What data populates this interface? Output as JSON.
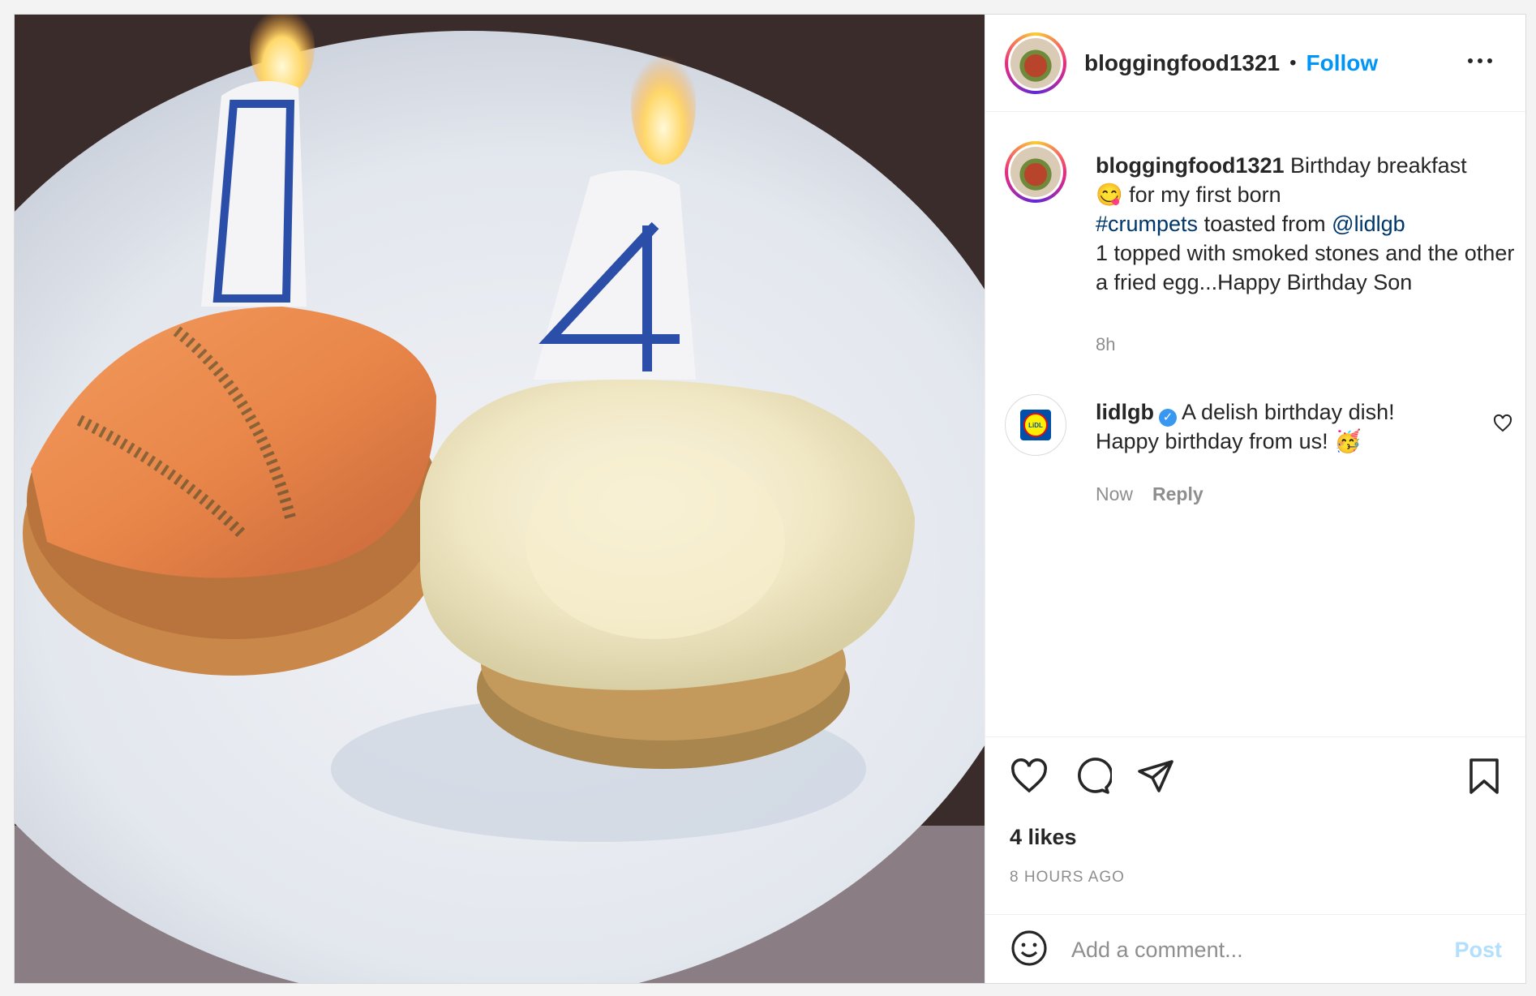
{
  "post": {
    "username": "bloggingfood1321",
    "follow_label": "Follow",
    "separator": "•",
    "caption_line_1": "Birthday breakfast",
    "caption_emoji_1": "😋",
    "caption_line_2": "for my first born",
    "caption_hashtag": "#crumpets",
    "caption_line_3": "toasted from",
    "caption_mention": "@lidlgb",
    "caption_line_4": "1 topped with smoked stones and the other a fried egg...Happy Birthday Son",
    "caption_time": "8h",
    "image_candles": [
      "1",
      "4"
    ]
  },
  "comment": {
    "username": "lidlgb",
    "verified_mark": "✓",
    "text_1": "A delish birthday dish!",
    "text_2": "Happy birthday from us!",
    "emoji": "🥳",
    "time": "Now",
    "reply_label": "Reply",
    "logo_text": "LiDL"
  },
  "footer": {
    "likes": "4 likes",
    "time_ago": "8 HOURS AGO",
    "comment_placeholder": "Add a comment...",
    "post_label": "Post"
  },
  "icons": {
    "like": "heart-icon",
    "comment": "comment-bubble-icon",
    "share": "paper-plane-icon",
    "save": "bookmark-icon",
    "emoji": "smiley-icon",
    "more": "more-dots-icon"
  },
  "colors": {
    "link_blue": "#0095f6",
    "hashtag_blue": "#00376b",
    "muted": "#8e8e8e",
    "post_disabled": "#b2dffc",
    "verified": "#3897f0"
  }
}
